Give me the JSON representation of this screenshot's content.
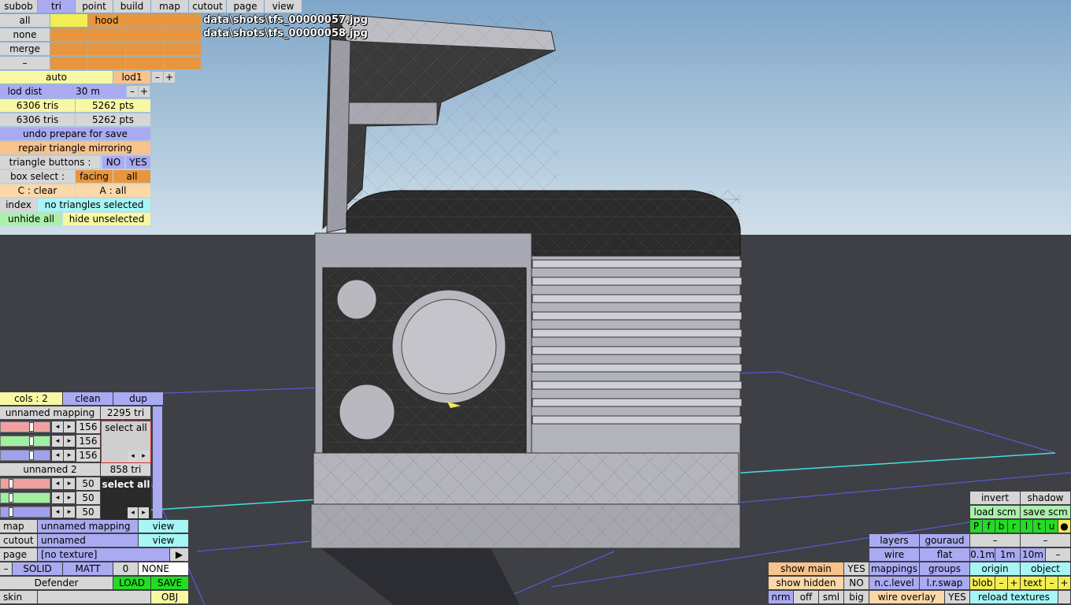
{
  "top_menu": [
    "subob",
    "tri",
    "point",
    "build",
    "map",
    "cutout",
    "page",
    "view"
  ],
  "overlay_lines": [
    "data\\shots\\tfs_00000057.jpg",
    "data\\shots\\tfs_00000058.jpg"
  ],
  "groups": {
    "all": "all",
    "none": "none",
    "merge": "merge",
    "minus": "–",
    "hood": "hood"
  },
  "lod": {
    "auto": "auto",
    "level": "lod1",
    "minus": "–",
    "plus": "+",
    "dist_label": "lod dist",
    "dist_value": "30 m"
  },
  "stats": {
    "tris1": "6306 tris",
    "pts1": "5262 pts",
    "tris2": "6306 tris",
    "pts2": "5262 pts"
  },
  "actions": {
    "undo": "undo prepare for save",
    "repair": "repair triangle mirroring",
    "tri_buttons_label": "triangle buttons :",
    "no": "NO",
    "yes": "YES",
    "box_select": "box select :",
    "facing": "facing",
    "all": "all",
    "c_clear": "C : clear",
    "a_all": "A : all",
    "index": "index",
    "no_sel": "no triangles selected",
    "unhide_all": "unhide all",
    "hide_unselected": "hide unselected"
  },
  "mapping_panel": {
    "cols": "cols : 2",
    "clean": "clean",
    "dup": "dup",
    "m1_name": "unnamed mapping",
    "m1_tris": "2295 tri",
    "m1_vals": [
      "156",
      "156",
      "156"
    ],
    "select_all": "select all",
    "m2_name": "unnamed 2",
    "m2_tris": "858 tri",
    "m2_vals": [
      "50",
      "50",
      "50"
    ],
    "left": "◂",
    "right": "▸"
  },
  "bottom_left": {
    "map_label": "map",
    "map_value": "unnamed mapping",
    "view": "view",
    "cutout_label": "cutout",
    "cutout_value": "unnamed",
    "page_label": "page",
    "page_value": "[no texture]",
    "play": "▶",
    "minus": "–",
    "solid": "SOLID",
    "matt": "MATT",
    "zero": "0",
    "none": "NONE",
    "defender": "Defender",
    "load": "LOAD",
    "save": "SAVE",
    "skin": "skin",
    "obj": "OBJ"
  },
  "bottom_right": {
    "show_main": "show main",
    "show_main_v": "YES",
    "show_hidden": "show hidden",
    "show_hidden_v": "NO",
    "nrm": "nrm",
    "off": "off",
    "sml": "sml",
    "big": "big",
    "layers": "layers",
    "gouraud": "gouraud",
    "wire": "wire",
    "flat": "flat",
    "mappings": "mappings",
    "groups": "groups",
    "nclevel": "n.c.level",
    "lrswap": "l.r.swap",
    "wire_overlay": "wire overlay",
    "wire_overlay_v": "YES",
    "invert": "invert",
    "shadow": "shadow",
    "load_scm": "load scm",
    "save_scm": "save scm",
    "views": [
      "P",
      "f",
      "b",
      "r",
      "l",
      "t",
      "u",
      "●"
    ],
    "minus": "–",
    "d01": "0.1m",
    "d1": "1m",
    "d10": "10m",
    "origin": "origin",
    "object": "object",
    "blob": "blob",
    "text": "text",
    "plus": "+",
    "reload": "reload textures"
  },
  "colors": {
    "sky_top": "#7fa6c9",
    "sky_bottom": "#c9dbe8",
    "floor": "#3f4046",
    "grid": "#5f5ff0",
    "grid_x": "#40e0e0"
  }
}
